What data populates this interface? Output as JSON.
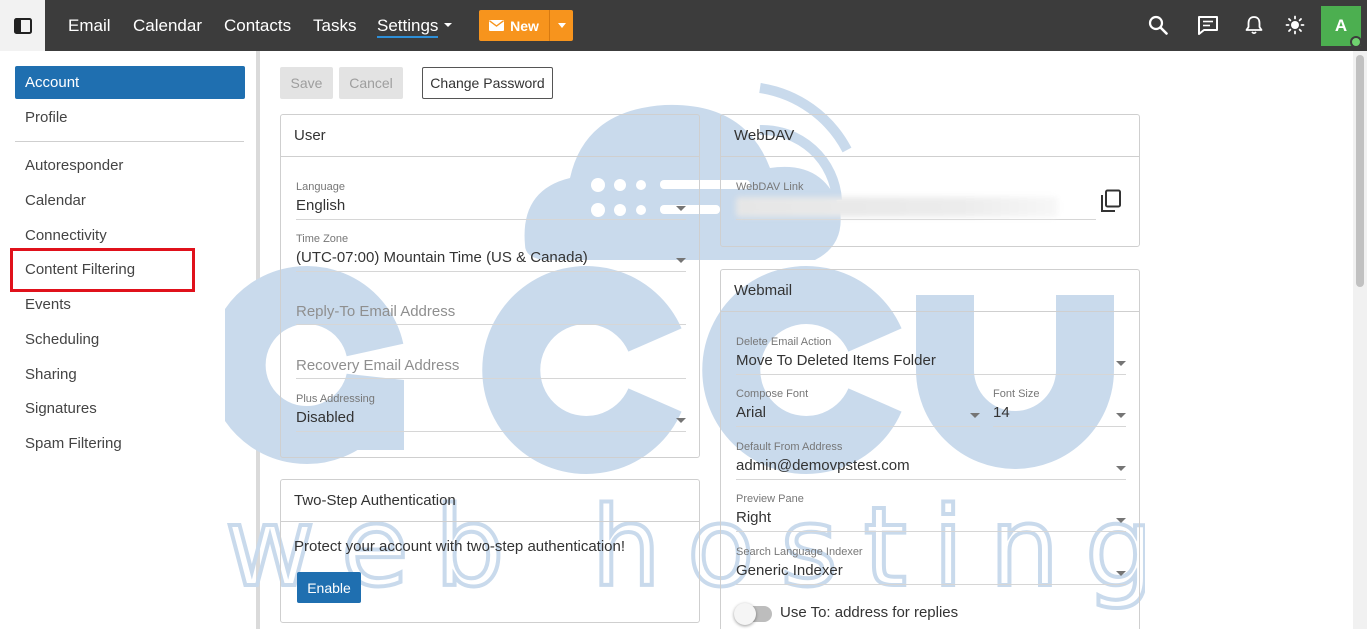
{
  "topbar": {
    "nav": [
      {
        "label": "Email"
      },
      {
        "label": "Calendar"
      },
      {
        "label": "Contacts"
      },
      {
        "label": "Tasks"
      },
      {
        "label": "Settings"
      }
    ],
    "active_nav": "Settings",
    "new_button": {
      "label": "New"
    },
    "icons": [
      "search-icon",
      "chat-icon",
      "bell-icon",
      "theme-icon"
    ],
    "avatar_initial": "A",
    "colors": {
      "bar": "#3c3c3c",
      "new_button": "#f7941d",
      "avatar": "#4caf50",
      "underline": "#2d8fd8"
    }
  },
  "sidebar": {
    "items": [
      {
        "label": "Account",
        "active": true
      },
      {
        "label": "Profile"
      },
      {
        "label": "Autoresponder"
      },
      {
        "label": "Calendar"
      },
      {
        "label": "Connectivity"
      },
      {
        "label": "Content Filtering",
        "highlighted": true
      },
      {
        "label": "Events"
      },
      {
        "label": "Scheduling"
      },
      {
        "label": "Sharing"
      },
      {
        "label": "Signatures"
      },
      {
        "label": "Spam Filtering"
      }
    ],
    "colors": {
      "active_bg": "#1f6fb0",
      "highlight_border": "#e0111b"
    }
  },
  "toolbar": {
    "save_label": "Save",
    "cancel_label": "Cancel",
    "change_password_label": "Change Password"
  },
  "user_card": {
    "title": "User",
    "language": {
      "label": "Language",
      "value": "English"
    },
    "time_zone": {
      "label": "Time Zone",
      "value": "(UTC-07:00) Mountain Time (US & Canada)"
    },
    "reply_to": {
      "placeholder": "Reply-To Email Address"
    },
    "recovery": {
      "placeholder": "Recovery Email Address"
    },
    "plus_addressing": {
      "label": "Plus Addressing",
      "value": "Disabled"
    }
  },
  "two_step_card": {
    "title": "Two-Step Authentication",
    "text": "Protect your account with two-step authentication!",
    "enable_label": "Enable"
  },
  "webdav_card": {
    "title": "WebDAV",
    "link_label": "WebDAV Link",
    "copy_icon": "copy-icon"
  },
  "webmail_card": {
    "title": "Webmail",
    "delete_action": {
      "label": "Delete Email Action",
      "value": "Move To Deleted Items Folder"
    },
    "compose_font": {
      "label": "Compose Font",
      "value": "Arial"
    },
    "font_size": {
      "label": "Font Size",
      "value": "14"
    },
    "default_from": {
      "label": "Default From Address",
      "value": "admin@demovpstest.com"
    },
    "preview_pane": {
      "label": "Preview Pane",
      "value": "Right"
    },
    "search_indexer": {
      "label": "Search Language Indexer",
      "value": "Generic Indexer"
    },
    "use_to": {
      "label": "Use To: address for replies",
      "on": false
    }
  },
  "watermark": {
    "word1": "accu",
    "word2": "web hosting",
    "color": "#c9daec"
  }
}
